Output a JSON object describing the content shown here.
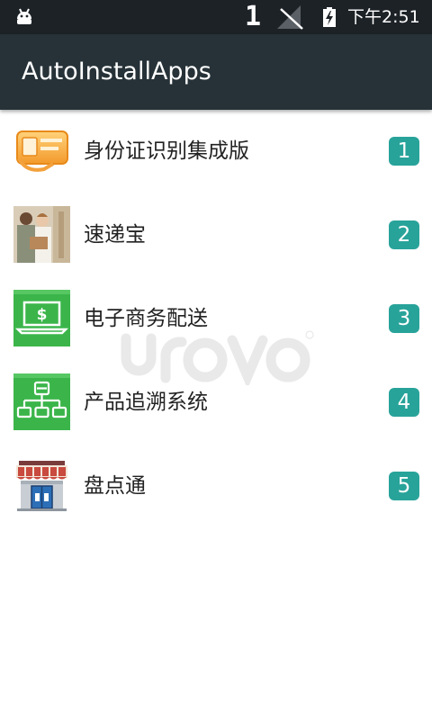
{
  "status_bar": {
    "notification_icon": "android-icon",
    "notification_count": "1",
    "signal_icon": "no-signal-icon",
    "battery_icon": "battery-charging-icon",
    "time": "下午2:51"
  },
  "app_bar": {
    "title": "AutoInstallApps"
  },
  "apps": [
    {
      "label": "身份证识别集成版",
      "badge": "1",
      "icon": "id-card-icon"
    },
    {
      "label": "速递宝",
      "badge": "2",
      "icon": "courier-photo-icon"
    },
    {
      "label": "电子商务配送",
      "badge": "3",
      "icon": "laptop-dollar-icon"
    },
    {
      "label": "产品追溯系统",
      "badge": "4",
      "icon": "hierarchy-chart-icon"
    },
    {
      "label": "盘点通",
      "badge": "5",
      "icon": "storefront-icon"
    }
  ],
  "watermark": {
    "text": "urovo"
  },
  "colors": {
    "status_bar": "#1d2227",
    "app_bar": "#263238",
    "badge": "#28a39a"
  }
}
